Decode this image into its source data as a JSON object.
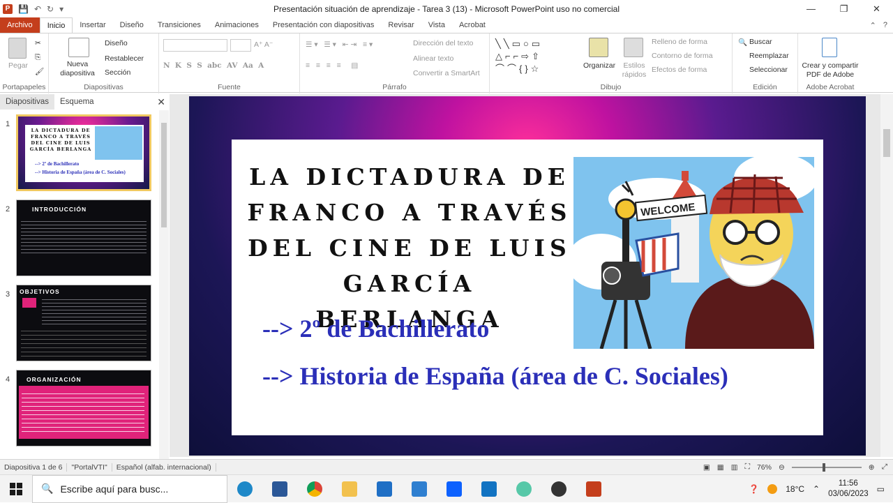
{
  "window": {
    "title": "Presentación situación de aprendizaje - Tarea 3 (13) - Microsoft PowerPoint uso no comercial",
    "minimize": "—",
    "restore": "❐",
    "close": "✕"
  },
  "ribbon_tabs": [
    "Archivo",
    "Inicio",
    "Insertar",
    "Diseño",
    "Transiciones",
    "Animaciones",
    "Presentación con diapositivas",
    "Revisar",
    "Vista",
    "Acrobat"
  ],
  "ribbon": {
    "portapapeles": {
      "label": "Portapapeles",
      "pegar": "Pegar"
    },
    "diapositivas": {
      "label": "Diapositivas",
      "nueva": "Nueva diapositiva",
      "diseno": "Diseño",
      "restablecer": "Restablecer",
      "seccion": "Sección"
    },
    "fuente": {
      "label": "Fuente"
    },
    "parrafo": {
      "label": "Párrafo",
      "direccion": "Dirección del texto",
      "alinear": "Alinear texto",
      "smartart": "Convertir a SmartArt"
    },
    "dibujo": {
      "label": "Dibujo",
      "organizar": "Organizar",
      "estilos": "Estilos rápidos",
      "relleno": "Relleno de forma",
      "contorno": "Contorno de forma",
      "efectos": "Efectos de forma"
    },
    "edicion": {
      "label": "Edición",
      "buscar": "Buscar",
      "reemplazar": "Reemplazar",
      "seleccionar": "Seleccionar"
    },
    "acrobat": {
      "label": "Adobe Acrobat",
      "crear": "Crear y compartir PDF de Adobe"
    }
  },
  "left_pane": {
    "tabs": [
      "Diapositivas",
      "Esquema"
    ],
    "thumbnails": [
      {
        "num": "1",
        "title": "LA DICTADURA DE FRANCO A TRAVÉS DEL CINE DE LUIS GARCÍA BERLANGA",
        "line1": "--> 2º de Bachillerato",
        "line2": "--> Historia de España (área de C. Sociales)"
      },
      {
        "num": "2",
        "title": "INTRODUCCIÓN"
      },
      {
        "num": "3",
        "title": "OBJETIVOS"
      },
      {
        "num": "4",
        "title": "ORGANIZACIÓN"
      }
    ]
  },
  "slide": {
    "title": "LA DICTADURA DE FRANCO A TRAVÉS DEL CINE DE LUIS GARCÍA BERLANGA",
    "line1_arrow": "--> ",
    "line1_text": "2º de Bachillerato",
    "line2_arrow": "--> ",
    "line2_text": "Historia de España (área de C. Sociales)",
    "sign_text": "WELCOME"
  },
  "status": {
    "slide": "Diapositiva 1 de 6",
    "theme": "\"PortalVTI\"",
    "language": "Español (alfab. internacional)",
    "zoom": "76%"
  },
  "taskbar": {
    "search_placeholder": "Escribe aquí para busc...",
    "temperature": "18°C",
    "time": "11:56",
    "date": "03/06/2023"
  }
}
